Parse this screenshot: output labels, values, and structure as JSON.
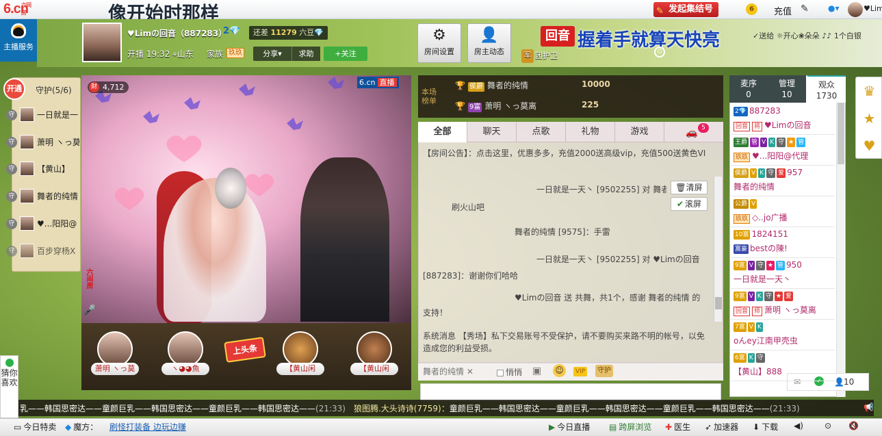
{
  "topbar": {
    "logo": "6.cn",
    "logo_small": "六间房",
    "song_title": "像开始时那样",
    "start_concert": "发起集结号",
    "coin_level": "6",
    "recharge": "充值",
    "user_name": "♥Lim"
  },
  "left_service": {
    "label": "主播服务"
  },
  "host": {
    "name": "♥Limの回音（887283）",
    "level": "2💎",
    "still_need_prefix": "还差",
    "still_need_value": "11279",
    "still_need_suffix": "六豆",
    "start_time": "开播 19:32",
    "location": "山东",
    "family_label": "家族",
    "family_badge": "玖玖",
    "share": "分享▾",
    "help": "求助",
    "follow": "+关注"
  },
  "header_buttons": {
    "room_settings": "房间设置",
    "owner_activity": "房主动态",
    "guard_group": "团护卫",
    "guard_badge": "军"
  },
  "banner": {
    "tag": "回音",
    "text": "握着手就算天快亮",
    "ticker": "✓送给 ☼开心❀朵朵 ♪♪ 1个白银"
  },
  "guard_panel": {
    "open_label": "开通",
    "title": "守护(5/6)",
    "items": [
      {
        "badge": "守",
        "name": "一日就是一"
      },
      {
        "badge": "守",
        "name": "萧明 ヽっ莫"
      },
      {
        "badge": "守",
        "name": "【黄山】"
      },
      {
        "badge": "守",
        "name": "舞者的纯情"
      },
      {
        "badge": "守",
        "name": "♥...阳阳@"
      },
      {
        "badge": "守",
        "name": "百步穿杨X"
      }
    ]
  },
  "video": {
    "viewers_icon": "财",
    "viewers": "4,712",
    "watermark": "6.cn",
    "live": "直播",
    "side_text": "六间房"
  },
  "mic_queue": [
    {
      "name": "萧明 ヽっ莫"
    },
    {
      "name": "ヽ◕◕魚"
    },
    {
      "name": "【黄山闲"
    },
    {
      "name": "【黄山闲"
    }
  ],
  "head_sign": "上头条",
  "guess_like": "猜你喜欢",
  "rank": {
    "label": "本场榜单",
    "rows": [
      {
        "level": "侯爵",
        "name": "舞者的纯情",
        "coins": "10000"
      },
      {
        "level": "9富",
        "name": "萧明 ヽっ莫离",
        "coins": "225"
      }
    ]
  },
  "chat": {
    "tabs": [
      "全部",
      "聊天",
      "点歌",
      "礼物",
      "游戏"
    ],
    "car_count": "5",
    "lines": [
      "【房间公告】：点击这里，优惠多多，充值2000送高级vip，充值500送黄色VI",
      "一日就是一天丶 [9502255] 对 舞者的纯情",
      "刷火山吧",
      "舞者的纯情 [9575]：手雷",
      "一日就是一天丶 [9502255] 对 ♥Limの回音",
      "[887283]：谢谢你们哈哈",
      "♥Limの回音 送 共舞，共1个，感谢 舞者的纯情 的",
      "支持！",
      "系统消息 【秀场】私下交易账号不受保护，请不要购买来路不明的帐号，以免",
      "造成您的利益受损。"
    ],
    "clear": "清屏",
    "scroll": "滚屏",
    "to_target": "舞者的纯情",
    "quiet": "悄悄",
    "vip": "VIP",
    "guard_tool": "守护"
  },
  "right_panel": {
    "tabs": [
      {
        "label": "麦序",
        "count": "0"
      },
      {
        "label": "管理",
        "count": "10"
      },
      {
        "label": "观众",
        "count": "1730"
      }
    ],
    "audience": [
      {
        "badges": [
          {
            "t": "2💎",
            "c": "#1565c0"
          }
        ],
        "name": "887283",
        "fam": "",
        "hr": ""
      },
      {
        "badges": [],
        "name": "♥Limの回音",
        "fam": "",
        "hr": "回音",
        "extra": "将"
      },
      {
        "badges": [
          {
            "t": "王爵",
            "c": "#2e7d32"
          },
          {
            "t": "管",
            "c": "#9c27b0"
          },
          {
            "t": "V",
            "c": "#7b1fa2"
          },
          {
            "t": "K",
            "c": "#26a69a"
          },
          {
            "t": "守",
            "c": "#666"
          },
          {
            "t": "★",
            "c": "#f39c12"
          },
          {
            "t": "管",
            "c": "#29b6f6"
          }
        ],
        "name": "",
        "fam": "",
        "hr": ""
      },
      {
        "badges": [],
        "name": "♥...阳阳@代理",
        "fam": "玖玖",
        "hr": ""
      },
      {
        "badges": [
          {
            "t": "侯爵",
            "c": "#d4a017"
          },
          {
            "t": "V",
            "c": "#e0a000"
          },
          {
            "t": "K",
            "c": "#26a69a"
          },
          {
            "t": "守",
            "c": "#666"
          },
          {
            "t": "爱",
            "c": "#e53935"
          }
        ],
        "name": "957",
        "fam": "",
        "hr": ""
      },
      {
        "badges": [],
        "name": "舞者的纯情",
        "fam": "",
        "hr": ""
      },
      {
        "badges": [
          {
            "t": "公爵",
            "c": "#c28b00"
          },
          {
            "t": "V",
            "c": "#e0a000"
          }
        ],
        "name": "",
        "fam": "",
        "hr": ""
      },
      {
        "badges": [],
        "name": "◇..jo广播",
        "fam": "玖玖",
        "hr": ""
      },
      {
        "badges": [
          {
            "t": "10富",
            "c": "#e0a000"
          }
        ],
        "name": "1824151",
        "fam": "",
        "hr": ""
      },
      {
        "badges": [
          {
            "t": "富豪",
            "c": "#3949ab"
          }
        ],
        "name": "bestの陳!",
        "fam": "",
        "hr": ""
      },
      {
        "badges": [
          {
            "t": "9富",
            "c": "#e0a000"
          },
          {
            "t": "V",
            "c": "#7b1fa2"
          },
          {
            "t": "守",
            "c": "#666"
          },
          {
            "t": "★",
            "c": "#e91e63"
          },
          {
            "t": "管",
            "c": "#29b6f6"
          }
        ],
        "name": "950",
        "fam": "",
        "hr": ""
      },
      {
        "badges": [],
        "name": "一日就是一天丶",
        "fam": "",
        "hr": ""
      },
      {
        "badges": [
          {
            "t": "9富",
            "c": "#e0a000"
          },
          {
            "t": "V",
            "c": "#7b1fa2"
          },
          {
            "t": "K",
            "c": "#26a69a"
          },
          {
            "t": "守",
            "c": "#666"
          },
          {
            "t": "★",
            "c": "#e53935"
          },
          {
            "t": "爱",
            "c": "#e53935"
          }
        ],
        "name": "",
        "fam": "",
        "hr": ""
      },
      {
        "badges": [],
        "name": "萧明 ヽっ莫离",
        "fam": "",
        "hr": "回音",
        "extra": "师"
      },
      {
        "badges": [
          {
            "t": "7富",
            "c": "#e0a000"
          },
          {
            "t": "V",
            "c": "#e0a000"
          },
          {
            "t": "K",
            "c": "#26a69a"
          }
        ],
        "name": "",
        "fam": "",
        "hr": ""
      },
      {
        "badges": [],
        "name": "oんey江南甲壳虫",
        "fam": "",
        "hr": ""
      },
      {
        "badges": [
          {
            "t": "6富",
            "c": "#e0a000"
          },
          {
            "t": "K",
            "c": "#26a69a"
          },
          {
            "t": "守",
            "c": "#666"
          }
        ],
        "name": "",
        "fam": "",
        "hr": ""
      },
      {
        "badges": [],
        "name": "【黄山】888",
        "fam": "",
        "hr": ""
      }
    ],
    "people_count": "10"
  },
  "marquee": {
    "text_a": "乳——韩国思密达——童颜巨乳——韩国思密达——童颜巨乳——韩国思密达——",
    "time_a": "(21:33)",
    "user": "狼图腾.大头诗诗(7759)：",
    "text_b": "童颜巨乳——韩国思密达——童颜巨乳——韩国思密达——童颜巨乳——韩国思密达——",
    "time_b": "(21:33)"
  },
  "statusbar": {
    "today_special": "今日特卖",
    "magic": "魔方：",
    "magic_link": "刷怪打装备 边玩边赚",
    "today_live": "今日直播",
    "cross_browse": "跨屏浏览",
    "doctor": "医生",
    "accelerator": "加速器",
    "download": "下载"
  }
}
